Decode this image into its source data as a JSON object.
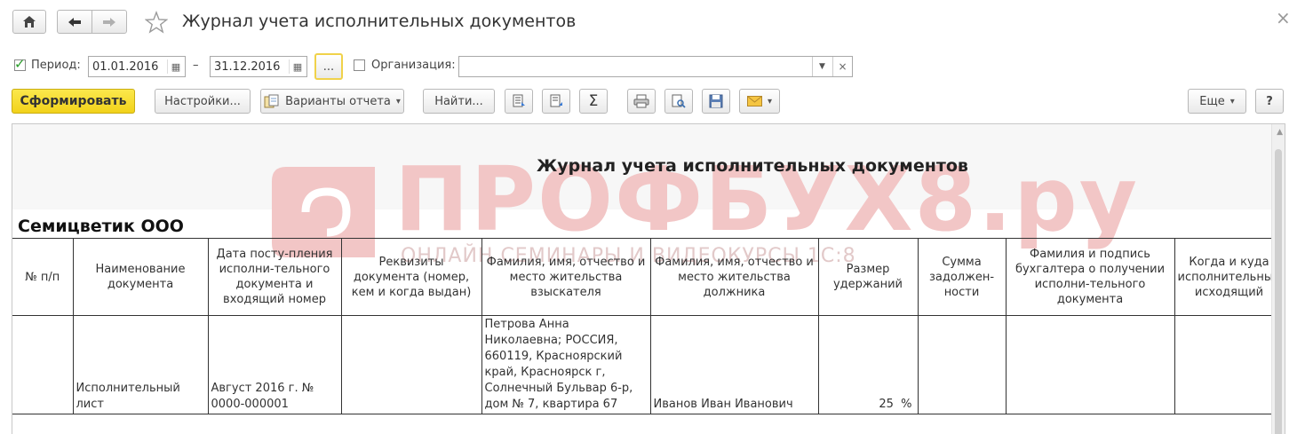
{
  "window": {
    "title": "Журнал учета исполнительных документов",
    "close_glyph": "×"
  },
  "filters": {
    "period_label": "Период:",
    "period_checked": true,
    "date_from": "01.01.2016",
    "date_separator": "–",
    "date_to": "31.12.2016",
    "period_select_label": "...",
    "organization_label": "Организация:",
    "organization_checked": false,
    "organization_value": ""
  },
  "toolbar": {
    "generate_label": "Сформировать",
    "settings_label": "Настройки...",
    "variants_label": "Варианты отчета",
    "find_label": "Найти...",
    "sum_glyph": "Σ",
    "more_label": "Еще",
    "help_label": "?"
  },
  "colors": {
    "generate_button": "#f5dc21",
    "checkbox_check": "#2a9d2a",
    "watermark": "#f2c6c6"
  },
  "report": {
    "title": "Журнал учета исполнительных документов",
    "organization": "Семицветик ООО",
    "watermark_text": "ПРОФБУХ8.ру",
    "watermark_sub": "ОНЛАЙН СЕМИНАРЫ И ВИДЕОКУРСЫ 1С:8",
    "columns": [
      "№ п/п",
      "Наименование документа",
      "Дата посту-пления исполни-тельного документа и входящий номер",
      "Реквизиты документа (номер, кем и когда выдан)",
      "Фамилия, имя, отчество и место жительства взыскателя",
      "Фамилия, имя, отчество и место жительства должника",
      "Размер удержаний",
      "Сумма задолжен-ности",
      "Фамилия и подпись бухгалтера о получении исполни-тельного документа",
      "Когда и куда исполнительный исходящий"
    ],
    "rows": [
      {
        "num": "",
        "doc_name": "Исполнительный лист",
        "date_in": "Август 2016 г. № 0000-000001",
        "requisites": "",
        "claimant": "Петрова Анна Николаевна; РОССИЯ, 660119, Красноярский край, Красноярск г, Солнечный Бульвар 6-р, дом № 7, квартира 67",
        "debtor": "Иванов Иван Иванович",
        "deduction": "25  %",
        "debt": "",
        "accountant": "",
        "sent": ""
      }
    ]
  }
}
